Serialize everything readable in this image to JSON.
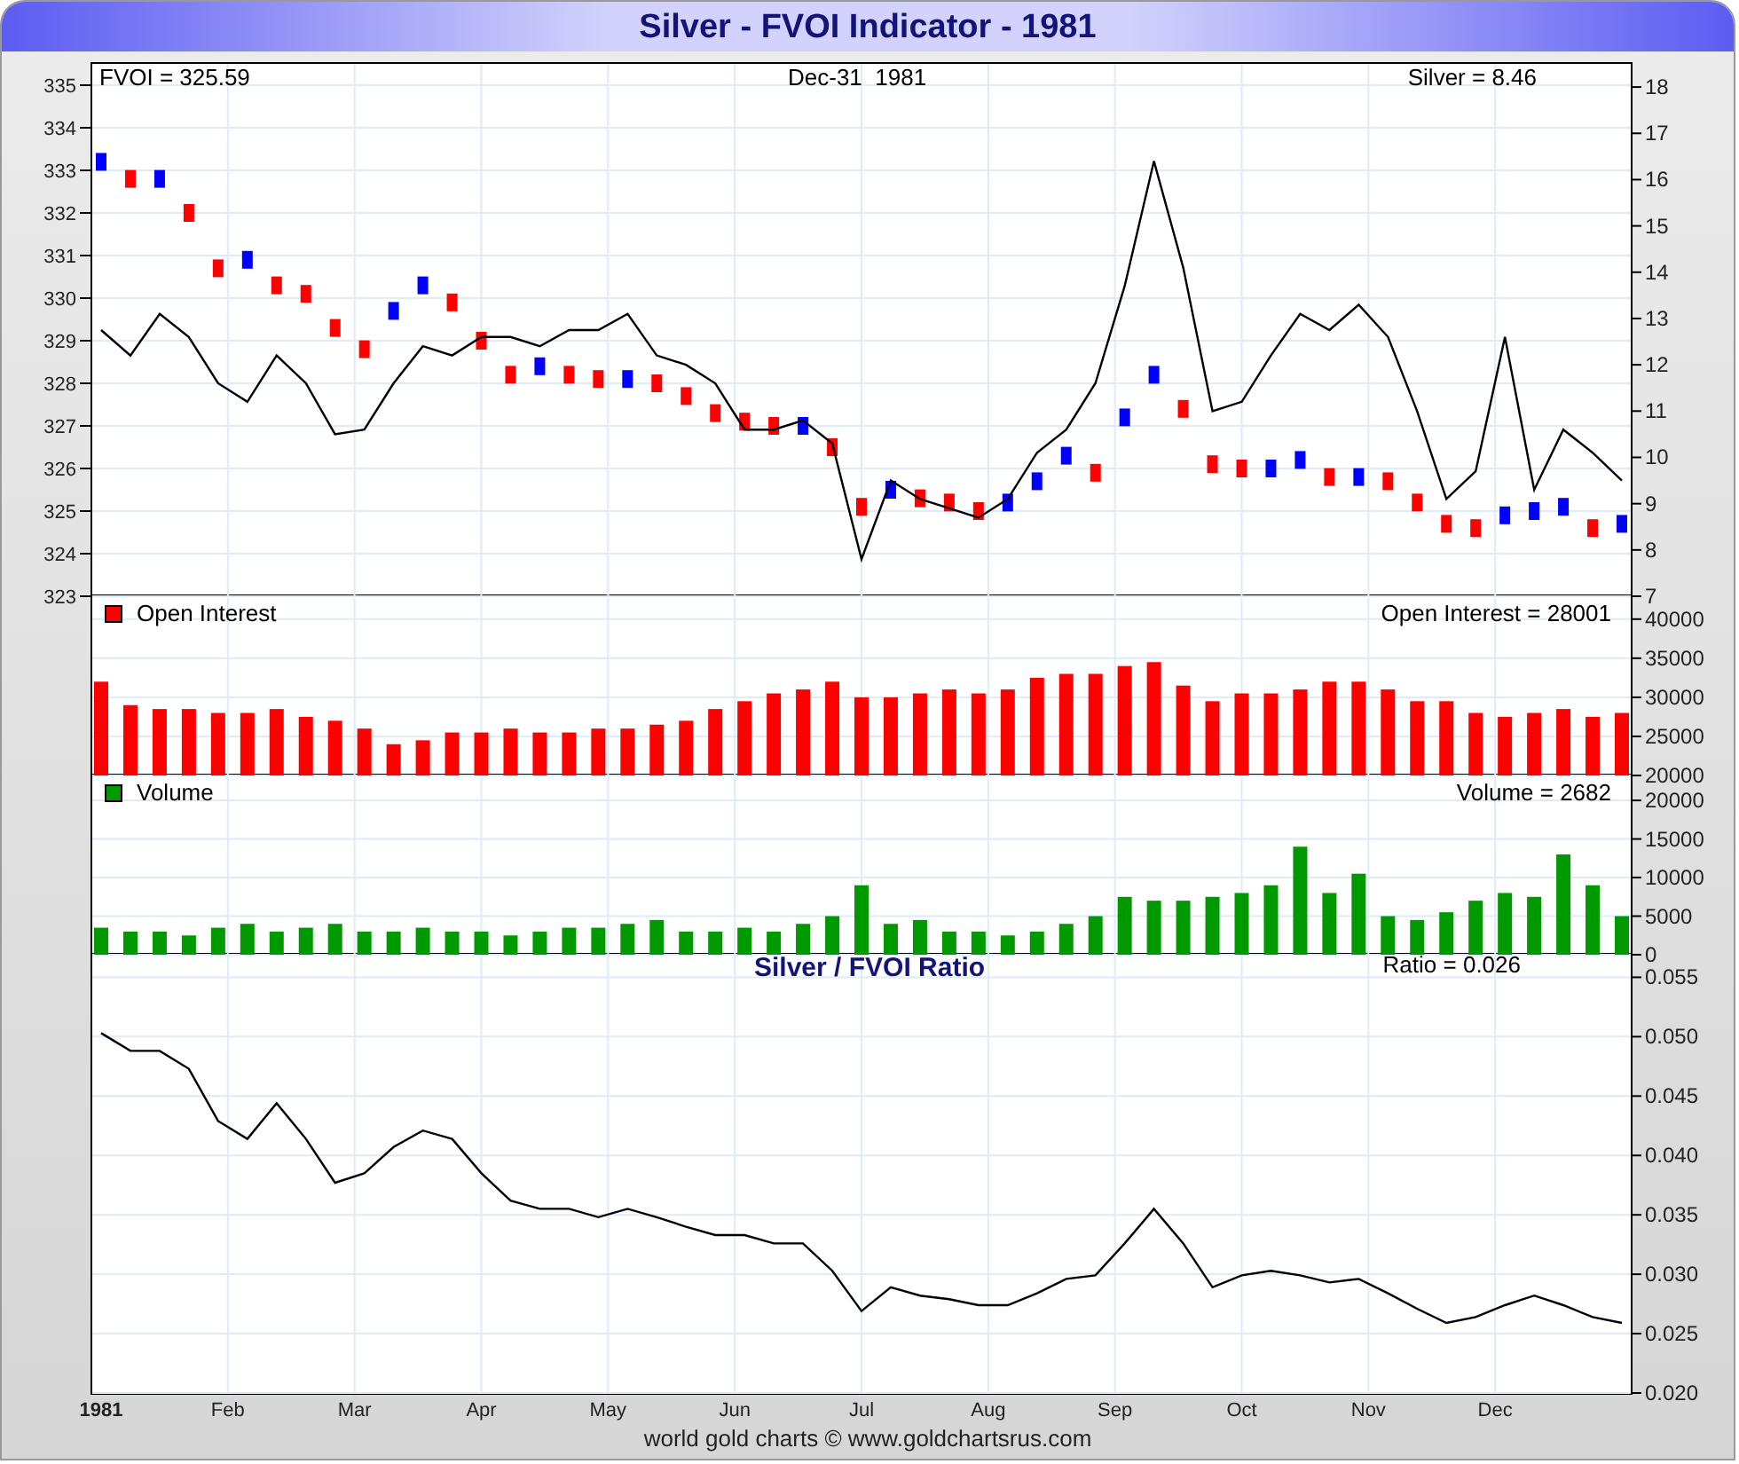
{
  "title": "Silver - FVOI Indicator - 1981",
  "price_panel": {
    "fvoi_label": "FVOI = 325.59",
    "date_label": "Dec-31  1981",
    "silver_label": "Silver = 8.46",
    "fvoi": {
      "chart_data": {
        "type": "scatter",
        "grid": true,
        "ylim": [
          323,
          335.5
        ],
        "yticks": [
          323,
          324,
          325,
          326,
          327,
          328,
          329,
          330,
          331,
          332,
          333,
          334,
          335
        ],
        "series": [
          {
            "color": "#ff0000",
            "values": [
              null,
              332.8,
              null,
              332.0,
              330.7,
              null,
              330.3,
              330.1,
              329.3,
              328.8,
              null,
              null,
              329.9,
              329.0,
              328.2,
              null,
              328.2,
              328.1,
              null,
              328.0,
              327.7,
              327.3,
              327.1,
              327.0,
              null,
              326.5,
              325.1,
              null,
              325.3,
              325.2,
              325.0,
              null,
              null,
              null,
              325.9,
              null,
              null,
              327.4,
              326.1,
              326.0,
              null,
              null,
              325.8,
              null,
              325.7,
              325.2,
              324.7,
              324.6,
              null,
              null,
              null,
              324.6,
              null
            ]
          },
          {
            "color": "#0000ff",
            "values": [
              333.2,
              null,
              332.8,
              null,
              null,
              330.9,
              null,
              null,
              null,
              null,
              329.7,
              330.3,
              null,
              null,
              null,
              328.4,
              null,
              null,
              328.1,
              null,
              null,
              null,
              null,
              null,
              327.0,
              null,
              null,
              325.5,
              null,
              null,
              null,
              325.2,
              325.7,
              326.3,
              null,
              327.2,
              328.2,
              null,
              null,
              null,
              326.0,
              326.2,
              null,
              325.8,
              null,
              null,
              null,
              null,
              324.9,
              325.0,
              325.1,
              null,
              324.7
            ]
          }
        ]
      }
    },
    "silver": {
      "chart_data": {
        "type": "line",
        "ylim": [
          7,
          18.5
        ],
        "yticks": [
          7,
          8,
          9,
          10,
          11,
          12,
          13,
          14,
          15,
          16,
          17,
          18
        ],
        "series": [
          {
            "color": "#000000",
            "values": [
              12.75,
              12.2,
              13.1,
              12.6,
              11.6,
              11.2,
              12.2,
              11.6,
              10.5,
              10.6,
              11.6,
              12.4,
              12.2,
              12.6,
              12.6,
              12.4,
              12.75,
              12.75,
              13.1,
              12.2,
              12.0,
              11.6,
              10.6,
              10.6,
              10.8,
              10.3,
              7.8,
              9.5,
              9.1,
              8.9,
              8.7,
              9.1,
              10.1,
              10.6,
              11.6,
              13.7,
              16.4,
              14.1,
              11.0,
              11.2,
              12.2,
              13.1,
              12.75,
              13.3,
              12.6,
              11.0,
              9.1,
              9.7,
              12.6,
              9.3,
              10.6,
              10.1,
              9.5
            ]
          }
        ]
      }
    }
  },
  "open_interest_panel": {
    "reading": "Open Interest = 28001",
    "chart_data": {
      "type": "bar",
      "grid": true,
      "ylim": [
        20000,
        42700
      ],
      "yticks": [
        20000,
        25000,
        30000,
        35000,
        40000
      ],
      "series": [
        {
          "name": "Open Interest",
          "color": "#ff0000",
          "values": [
            32000,
            29000,
            28500,
            28500,
            28000,
            28000,
            28500,
            27500,
            27000,
            26000,
            24000,
            24500,
            25500,
            25500,
            26000,
            25500,
            25500,
            26000,
            26000,
            26500,
            27000,
            28500,
            29500,
            30500,
            31000,
            32000,
            30000,
            30000,
            30500,
            31000,
            30500,
            31000,
            32500,
            33000,
            33000,
            34000,
            34500,
            31500,
            29500,
            30500,
            30500,
            31000,
            32000,
            32000,
            31000,
            29500,
            29500,
            28000,
            27500,
            28000,
            28500,
            27500,
            28000
          ]
        }
      ]
    }
  },
  "volume_panel": {
    "reading": "Volume = 2682",
    "chart_data": {
      "type": "bar",
      "grid": true,
      "ylim": [
        0,
        23000
      ],
      "yticks": [
        0,
        5000,
        10000,
        15000,
        20000
      ],
      "series": [
        {
          "name": "Volume",
          "color": "#009900",
          "values": [
            3500,
            3000,
            3000,
            2500,
            3500,
            4000,
            3000,
            3500,
            4000,
            3000,
            3000,
            3500,
            3000,
            3000,
            2500,
            3000,
            3500,
            3500,
            4000,
            4500,
            3000,
            3000,
            3500,
            3000,
            4000,
            5000,
            9000,
            4000,
            4500,
            3000,
            3000,
            2500,
            3000,
            4000,
            5000,
            7500,
            7000,
            7000,
            7500,
            8000,
            9000,
            14000,
            8000,
            10500,
            5000,
            4500,
            5500,
            7000,
            8000,
            7500,
            13000,
            9000,
            5000
          ]
        }
      ]
    }
  },
  "ratio_panel": {
    "reading": "Ratio = 0.026",
    "chart_data": {
      "type": "line",
      "grid": true,
      "title": "Silver / FVOI Ratio",
      "ylim": [
        0.02,
        0.0569
      ],
      "yticks": [
        {
          "value": 0.02,
          "label": "0.020"
        },
        {
          "value": 0.025,
          "label": "0.025"
        },
        {
          "value": 0.03,
          "label": "0.030"
        },
        {
          "value": 0.035,
          "label": "0.035"
        },
        {
          "value": 0.04,
          "label": "0.040"
        },
        {
          "value": 0.045,
          "label": "0.045"
        },
        {
          "value": 0.05,
          "label": "0.050"
        },
        {
          "value": 0.055,
          "label": "0.055"
        }
      ],
      "series": [
        {
          "color": "#000000",
          "values": [
            0.0503,
            0.0488,
            0.0488,
            0.0473,
            0.0429,
            0.0414,
            0.0444,
            0.0414,
            0.0377,
            0.0385,
            0.0407,
            0.0421,
            0.0414,
            0.0385,
            0.0362,
            0.0355,
            0.0355,
            0.0348,
            0.0355,
            0.0348,
            0.034,
            0.0333,
            0.0333,
            0.0326,
            0.0326,
            0.0303,
            0.0269,
            0.0289,
            0.0282,
            0.0279,
            0.0274,
            0.0274,
            0.0284,
            0.0296,
            0.0299,
            0.0326,
            0.0355,
            0.0326,
            0.0289,
            0.0299,
            0.0303,
            0.0299,
            0.0293,
            0.0296,
            0.0284,
            0.0271,
            0.0259,
            0.0264,
            0.0274,
            0.0282,
            0.0274,
            0.0264,
            0.0259
          ]
        }
      ]
    }
  },
  "months": [
    "1981",
    "Feb",
    "Mar",
    "Apr",
    "May",
    "Jun",
    "Jul",
    "Aug",
    "Sep",
    "Oct",
    "Nov",
    "Dec"
  ],
  "footer": "world gold charts © www.goldchartsrus.com"
}
